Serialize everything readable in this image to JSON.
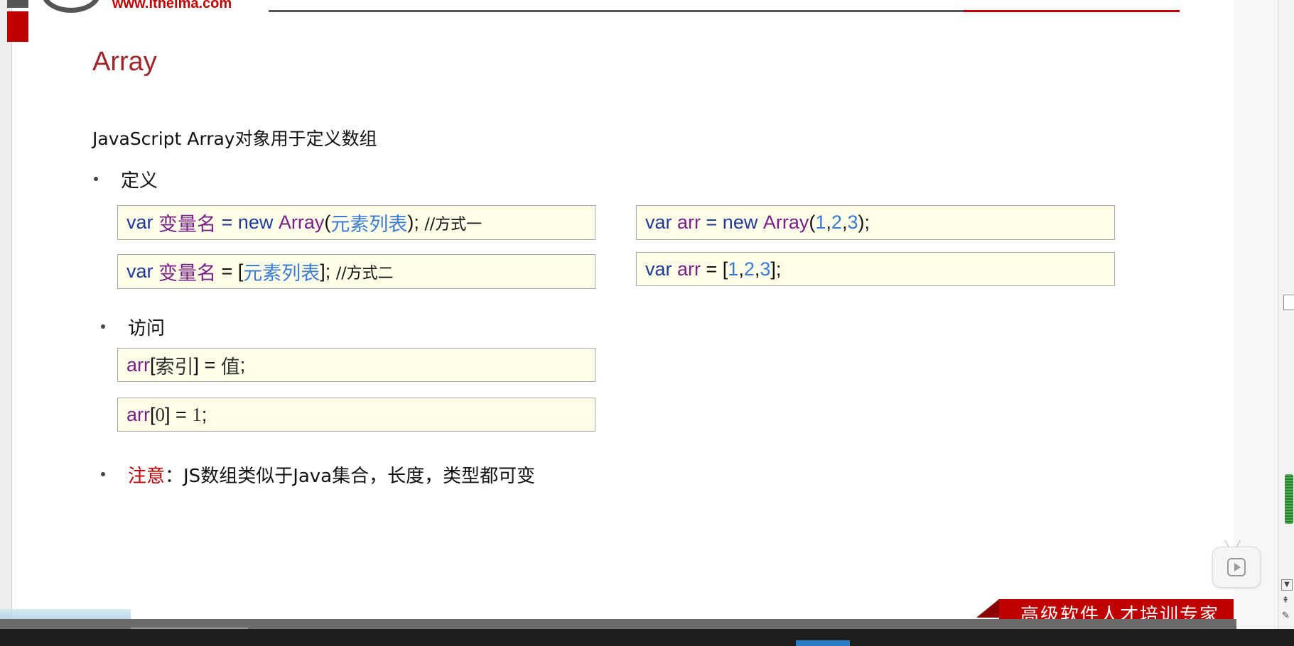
{
  "logo": {
    "url_text": "www.itheima.com"
  },
  "slide": {
    "title": "Array",
    "intro": "JavaScript Array对象用于定义数组",
    "section_define": "定义",
    "section_access": "访问",
    "note_key": "注意",
    "note_text": "：JS数组类似于Java集合，长度，类型都可变"
  },
  "code": {
    "def1": {
      "kw1": "var ",
      "name": "变量名",
      "eq": " = ",
      "kw2": "new ",
      "cls": "Array",
      "p1": "(",
      "arg": "元素列表",
      "p2": "); ",
      "comment": "//方式一"
    },
    "def2": {
      "kw1": "var ",
      "name": "变量名",
      "eq": " = [",
      "arg": "元素列表",
      "p2": "]; ",
      "comment": "//方式二"
    },
    "ex1": {
      "kw1": "var ",
      "name": "arr",
      "eq": " = ",
      "kw2": "new ",
      "cls": "Array",
      "p1": "(",
      "n1": "1",
      "c1": ",",
      "n2": "2",
      "c2": ",",
      "n3": "3",
      "p2": ");"
    },
    "ex2": {
      "kw1": "var ",
      "name": "arr",
      "eq": " = [",
      "n1": "1",
      "c1": ",",
      "n2": "2",
      "c2": ",",
      "n3": "3",
      "p2": "];"
    },
    "acc1": {
      "name": "arr",
      "open": "[",
      "idx": "索引",
      "close": "] = ",
      "val": "值",
      "semi": ";"
    },
    "acc2": {
      "name": "arr",
      "open": "[",
      "idx": "0",
      "close": "] = ",
      "val": "1",
      "semi": ";"
    }
  },
  "footer": {
    "slogan": "高级软件人才培训专家"
  },
  "icons": [
    "play-icon",
    "scroll-down-icon",
    "scroll-page-up-icon",
    "pin-icon"
  ],
  "colors": {
    "title": "#a0262a",
    "accent_red": "#c00000",
    "code_bg": "#fefee8"
  }
}
